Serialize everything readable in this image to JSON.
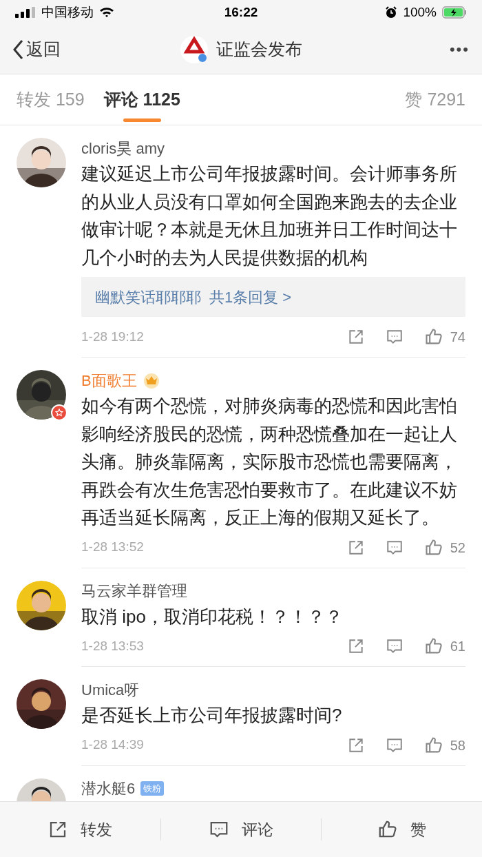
{
  "status_bar": {
    "carrier": "中国移动",
    "time": "16:22",
    "battery": "100%"
  },
  "nav": {
    "back": "返回",
    "title": "证监会发布",
    "more": "•••"
  },
  "tabs": [
    {
      "label": "转发",
      "count": "159",
      "selected": false
    },
    {
      "label": "评论",
      "count": "1125",
      "selected": true
    },
    {
      "label": "赞",
      "count": "7291",
      "selected": false
    }
  ],
  "comments": [
    {
      "name": "cloris昊 amy",
      "member": false,
      "star_badge": false,
      "text": "建议延迟上市公司年报披露时间。会计师事务所的从业人员没有口罩如何全国跑来跑去的去企业做审计呢？本就是无休且加班并日工作时间达十几个小时的去为人民提供数据的机构",
      "replies": {
        "user": "幽默笑话耶耶耶",
        "summary": "共1条回复 >"
      },
      "time": "1-28 19:12",
      "likes": "74"
    },
    {
      "name": "B面歌王",
      "member": true,
      "star_badge": true,
      "text": "如今有两个恐慌，对肺炎病毒的恐慌和因此害怕影响经济股民的恐慌，两种恐慌叠加在一起让人头痛。肺炎靠隔离，实际股市恐慌也需要隔离，再跌会有次生危害恐怕要救市了。在此建议不妨再适当延长隔离，反正上海的假期又延长了。",
      "time": "1-28 13:52",
      "likes": "52"
    },
    {
      "name": "马云家羊群管理",
      "member": false,
      "star_badge": false,
      "text": "取消 ipo，取消印花税！？！？？",
      "time": "1-28 13:53",
      "likes": "61"
    },
    {
      "name": "Umica呀",
      "member": false,
      "star_badge": false,
      "text": "是否延长上市公司年报披露时间?",
      "time": "1-28 14:39",
      "likes": "58"
    },
    {
      "name": "潜水艇6",
      "member": false,
      "fan_badge": "铁粉"
    }
  ],
  "bottom_bar": [
    {
      "kind": "repost",
      "label": "转发"
    },
    {
      "kind": "comment",
      "label": "评论"
    },
    {
      "kind": "like",
      "label": "赞"
    }
  ]
}
